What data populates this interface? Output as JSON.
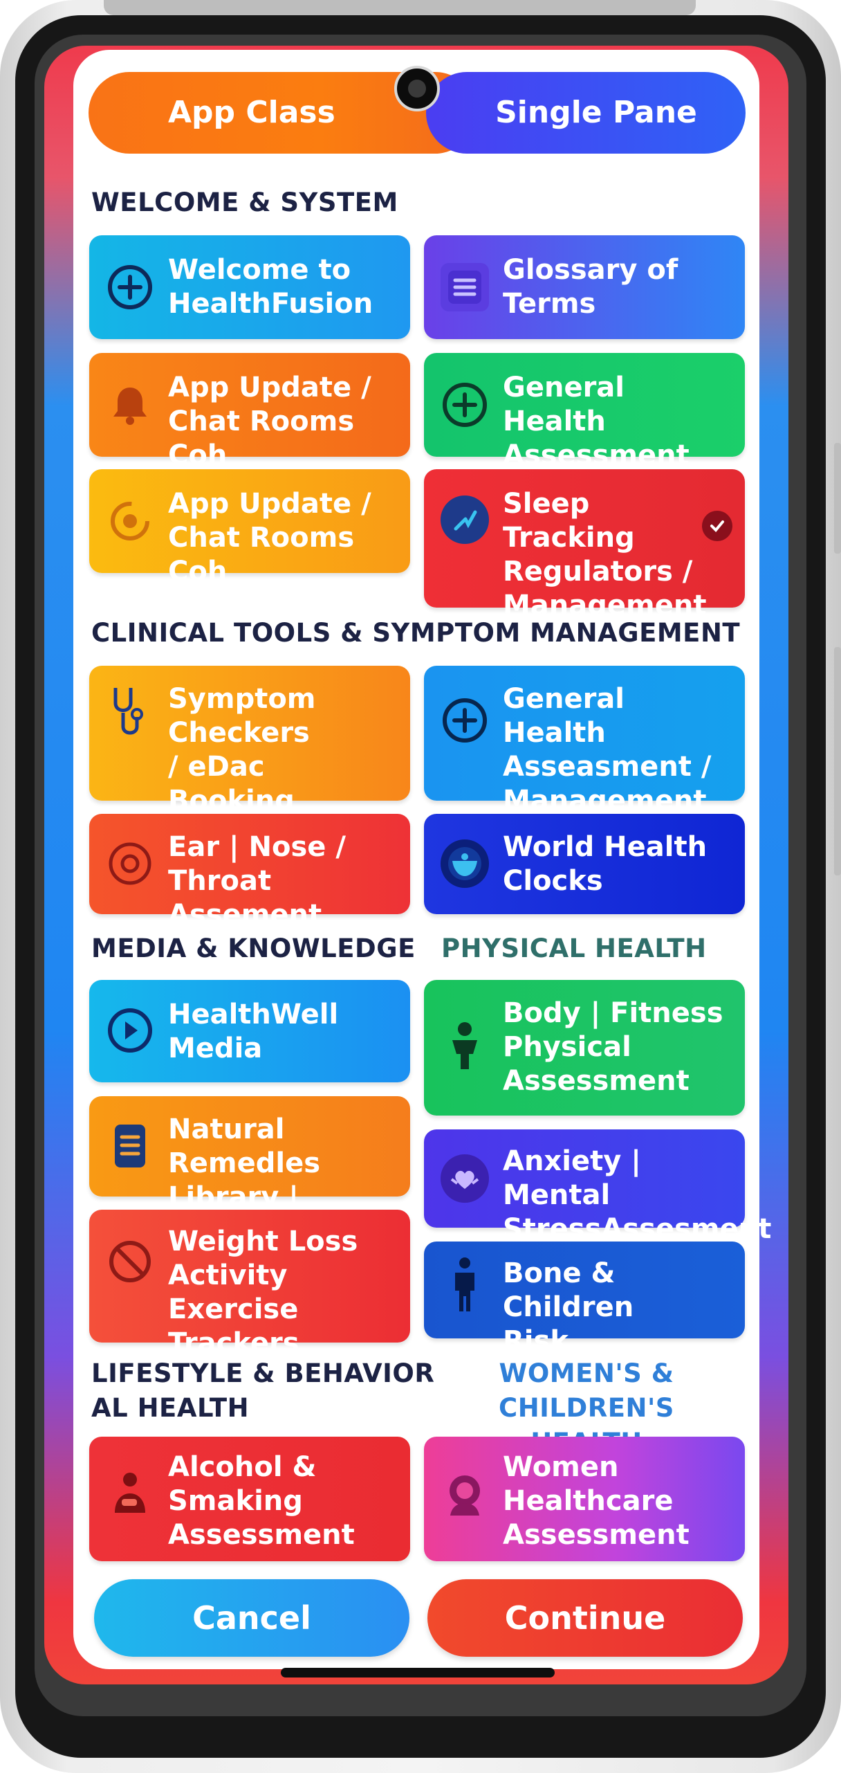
{
  "segmented_control": {
    "left_label": "App Class",
    "right_label": "Single Pane"
  },
  "sections": {
    "welcome_system": "WELCOME & SYSTEM",
    "clinical": "CLINICAL TOOLS & SYMPTOM MANAGEMENT",
    "media": "MEDIA & KNOWLEDGE",
    "physical": "PHYSICAL HEALTH",
    "lifestyle": "LIFESTYLE & BEHAVIOR\nAL HEALTH",
    "womens": "WOMEN'S &\nCHILDREN'S HEALTH"
  },
  "tiles": {
    "welcome": "Welcome to\nHealthFusion",
    "glossary": "Glossary of\nTerms",
    "app_update_1": "App Update /\nChat Rooms Coh",
    "general_health_assessment": "General Health\nAssessment",
    "app_update_2": "App Update /\nChat Rooms Coh",
    "sleep_tracking": "Sleep Tracking\nRegulators /\nManagement",
    "symptom_checkers": "Symptom\nCheckers\n/ eDac Booking",
    "general_health_mgmt": "General Health\nAsseasment /\nManagement",
    "ent": "Ear | Nose /\nThroat Assement",
    "world_clocks": "World Health\nClocks",
    "healthwell_media": "HealthWell\nMedia",
    "body_fitness": "Body | Fitness\nPhysical\nAssessment",
    "natural_remedies": "Natural Remedles\nLibrary | Database",
    "anxiety": "Anxiety | Mental\nStressAssesment",
    "weight_loss": "Weight Loss\nActivity\nExercise Trackers",
    "bone_children": "Bone & Children\nRisk Assessment",
    "alcohol": "Alcohol &\nSmaking\nAssessment",
    "women_healthcare": "Women\nHealthcare\nAssessment"
  },
  "buttons": {
    "cancel": "Cancel",
    "continue": "Continue"
  },
  "colors": {
    "orange": "#f97316",
    "blue": "#1e90f5",
    "indigo": "#4a3cf0",
    "green": "#18c466",
    "red": "#ee2f36",
    "navy_title": "#1c2244",
    "physical_heading": "#2f6f6a",
    "womens_heading": "#2f7fd8"
  },
  "icons": [
    "plus-circle-icon",
    "list-icon",
    "bell-icon",
    "plus-circle-icon",
    "sync-icon",
    "sleep-icon",
    "stethoscope-icon",
    "plus-circle-icon",
    "ear-icon",
    "globe-icon",
    "play-icon",
    "person-icon",
    "book-icon",
    "heart-hands-icon",
    "no-sign-icon",
    "person-standing-icon",
    "drinker-icon",
    "woman-icon"
  ]
}
